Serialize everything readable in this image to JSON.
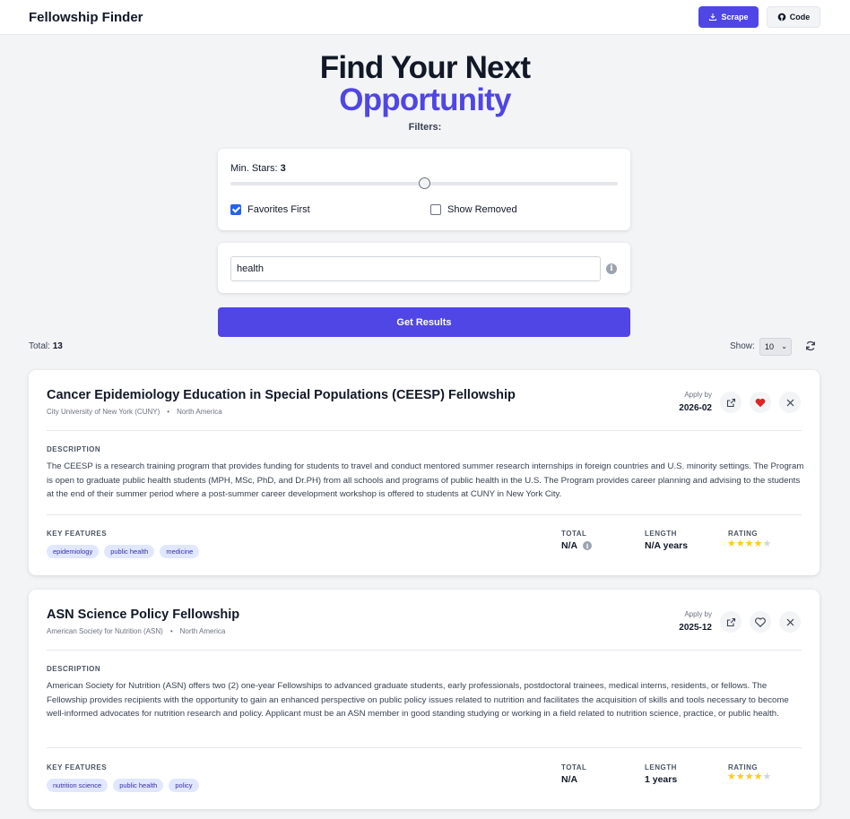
{
  "header": {
    "brand": "Fellowship Finder",
    "scrape_label": "Scrape",
    "code_label": "Code"
  },
  "hero": {
    "line1": "Find Your Next",
    "line2": "Opportunity",
    "filters_label": "Filters:"
  },
  "filters": {
    "min_stars_label": "Min. Stars:",
    "min_stars_value": "3",
    "favorites_first_label": "Favorites First",
    "favorites_first_checked": true,
    "show_removed_label": "Show Removed",
    "show_removed_checked": false,
    "search_value": "health",
    "get_results_label": "Get Results"
  },
  "results_bar": {
    "total_label": "Total:",
    "total_value": "13",
    "show_label": "Show:",
    "show_value": "10"
  },
  "labels": {
    "apply_by": "Apply by",
    "description": "DESCRIPTION",
    "key_features": "KEY FEATURES",
    "total": "TOTAL",
    "length": "LENGTH",
    "rating": "RATING"
  },
  "colors": {
    "accent": "#4f46e5",
    "favorite": "#dc2626",
    "star": "#facc15"
  },
  "results": [
    {
      "title": "Cancer Epidemiology Education in Special Populations (CEESP) Fellowship",
      "org": "City University of New York (CUNY)",
      "region": "North America",
      "apply_by": "2026-02",
      "favorited": true,
      "description": "The CEESP is a research training program that provides funding for students to travel and conduct mentored summer research internships in foreign countries and U.S. minority settings. The Program is open to graduate public health students (MPH, MSc, PhD, and Dr.PH) from all schools and programs of public health in the U.S. The Program provides career planning and advising to the students at the end of their summer period where a post-summer career development workshop is offered to students at CUNY in New York City.",
      "tags": [
        "epidemiology",
        "public health",
        "medicine"
      ],
      "total": "N/A",
      "length": "N/A years",
      "rating": 4
    },
    {
      "title": "ASN Science Policy Fellowship",
      "org": "American Society for Nutrition (ASN)",
      "region": "North America",
      "apply_by": "2025-12",
      "favorited": false,
      "description": "American Society for Nutrition (ASN) offers two (2) one-year Fellowships to advanced graduate students, early professionals, postdoctoral trainees, medical interns, residents, or fellows. The Fellowship provides recipients with the opportunity to gain an enhanced perspective on public policy issues related to nutrition and facilitates the acquisition of skills and tools necessary to become well-informed advocates for nutrition research and policy. Applicant must be an ASN member in good standing studying or working in a field related to nutrition science, practice, or public health.",
      "tags": [
        "nutrition science",
        "public health",
        "policy"
      ],
      "total": "N/A",
      "length": "1 years",
      "rating": 4
    }
  ]
}
